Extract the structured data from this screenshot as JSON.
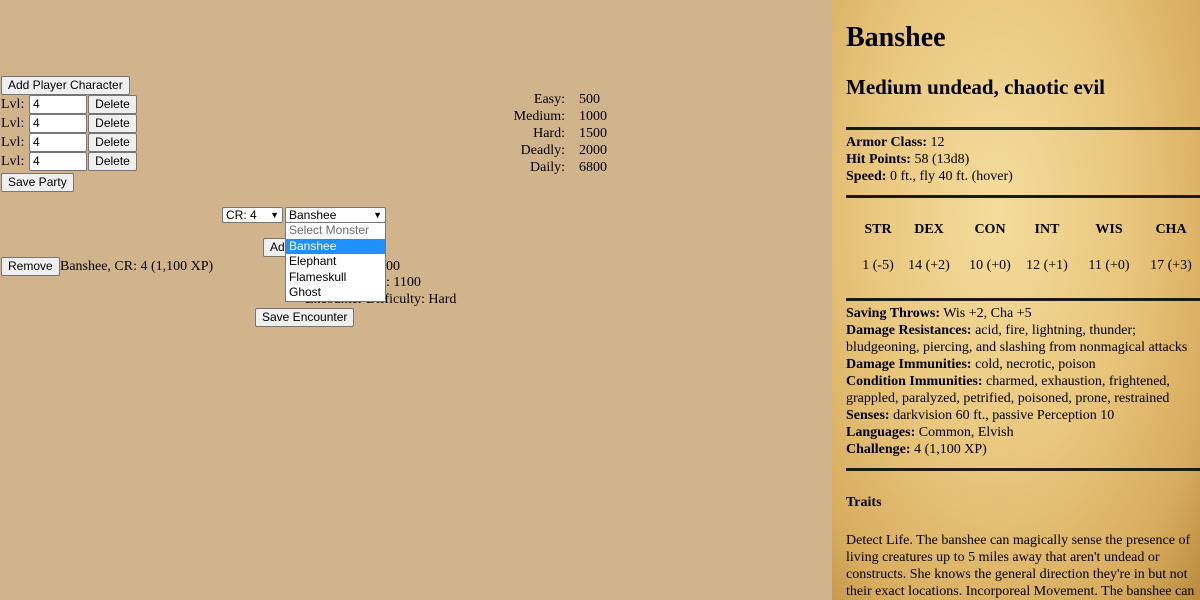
{
  "party": {
    "add_button": "Add Player Character",
    "rows": [
      {
        "label": "Lvl:",
        "value": "4",
        "delete": "Delete"
      },
      {
        "label": "Lvl:",
        "value": "4",
        "delete": "Delete"
      },
      {
        "label": "Lvl:",
        "value": "4",
        "delete": "Delete"
      },
      {
        "label": "Lvl:",
        "value": "4",
        "delete": "Delete"
      }
    ],
    "save_button": "Save Party"
  },
  "thresholds": [
    {
      "label": "Easy:",
      "value": "500"
    },
    {
      "label": "Medium:",
      "value": "1000"
    },
    {
      "label": "Hard:",
      "value": "1500"
    },
    {
      "label": "Deadly:",
      "value": "2000"
    },
    {
      "label": "Daily:",
      "value": "6800"
    }
  ],
  "monster_picker": {
    "cr_selected": "CR: 4",
    "monster_selected": "Banshee",
    "options": [
      "Select Monster",
      "Banshee",
      "Elephant",
      "Flameskull",
      "Ghost"
    ],
    "add_button_partial": "Ad"
  },
  "encounter": {
    "remove_button": "Remove",
    "entry": "Banshee, CR: 4 (1,100 XP)",
    "total_partial": "00",
    "adjusted_partial": ": 1100",
    "difficulty_label": "Encounter Difficulty:",
    "difficulty_value": "Hard",
    "save_button": "Save Encounter"
  },
  "statblock": {
    "name": "Banshee",
    "type": "Medium undead, chaotic evil",
    "armor_class": {
      "label": "Armor Class:",
      "value": "12"
    },
    "hit_points": {
      "label": "Hit Points:",
      "value": "58 (13d8)"
    },
    "speed": {
      "label": "Speed:",
      "value": "0 ft., fly 40 ft. (hover)"
    },
    "abilities": [
      {
        "name": "STR",
        "value": "1 (-5)"
      },
      {
        "name": "DEX",
        "value": "14 (+2)"
      },
      {
        "name": "CON",
        "value": "10 (+0)"
      },
      {
        "name": "INT",
        "value": "12 (+1)"
      },
      {
        "name": "WIS",
        "value": "11 (+0)"
      },
      {
        "name": "CHA",
        "value": "17 (+3)"
      }
    ],
    "saving_throws": {
      "label": "Saving Throws:",
      "value": "Wis +2, Cha +5"
    },
    "damage_resistances": {
      "label": "Damage Resistances:",
      "value": "acid, fire, lightning, thunder;",
      "value2": "bludgeoning, piercing, and slashing from nonmagical attacks"
    },
    "damage_immunities": {
      "label": "Damage Immunities:",
      "value": "cold, necrotic, poison"
    },
    "condition_immunities": {
      "label": "Condition Immunities:",
      "value": "charmed, exhaustion, frightened,",
      "value2": "grappled, paralyzed, petrified, poisoned, prone, restrained"
    },
    "senses": {
      "label": "Senses:",
      "value": "darkvision 60 ft., passive Perception 10"
    },
    "languages": {
      "label": "Languages:",
      "value": "Common, Elvish"
    },
    "challenge": {
      "label": "Challenge:",
      "value": "4 (1,100 XP)"
    },
    "traits_heading": "Traits",
    "traits_text": "Detect Life. The banshee can magically sense the presence of living creatures up to 5 miles away that aren't undead or constructs. She knows the general direction they're in but not their exact locations. Incorporeal Movement. The banshee can"
  }
}
